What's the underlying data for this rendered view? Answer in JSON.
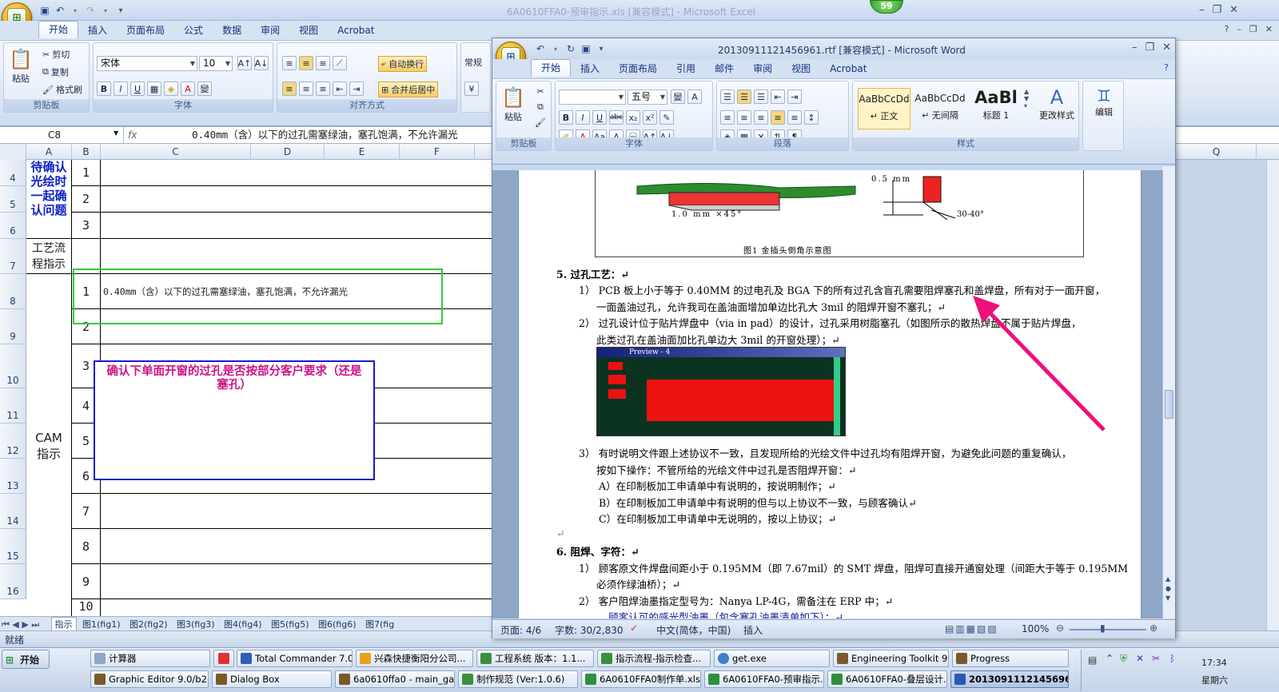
{
  "excel": {
    "title": "6A0610FFA0-预审指示.xls  [兼容模式] - Microsoft Excel",
    "tabs": [
      "开始",
      "插入",
      "页面布局",
      "公式",
      "数据",
      "审阅",
      "视图",
      "Acrobat"
    ],
    "ribbon": {
      "paste": "粘贴",
      "cut": "剪切",
      "copy": "复制",
      "format_painter": "格式刷",
      "clipboard": "剪贴板",
      "font_name": "宋体",
      "font_size": "10",
      "font_group": "字体",
      "align_group": "对齐方式",
      "wrap_text": "自动换行",
      "merge_center": "合并后居中",
      "number_format": "常规"
    },
    "name_box": "C8",
    "formula": "0.40mm（含）以下的过孔需塞绿油，塞孔饱满，不允许漏光",
    "columns": [
      "A",
      "B",
      "C",
      "D",
      "E",
      "F",
      "Q"
    ],
    "rows": [
      "4",
      "5",
      "6",
      "7",
      "8",
      "9",
      "10",
      "11",
      "12",
      "13",
      "14",
      "15",
      "16"
    ],
    "a_confirm": "待确认光绘时一起确认问题",
    "a_process": "工艺流程指示",
    "a_cam": "CAM指示",
    "b_confirm": [
      "1",
      "2",
      "3"
    ],
    "b_cam": [
      "1",
      "2",
      "3",
      "4",
      "5",
      "6",
      "7",
      "8",
      "9",
      "10"
    ],
    "c8_text": "0.40mm（含）以下的过孔需塞绿油，塞孔饱满，不允许漏光",
    "note_text": "确认下单面开窗的过孔是否按部分客户要求（还是塞孔）",
    "sheet_tabs": [
      "指示",
      "图1(fig1)",
      "图2(fig2)",
      "图3(fig3)",
      "图4(fig4)",
      "图5(fig5)",
      "图6(fig6)",
      "图7(fig"
    ],
    "status": "就绪"
  },
  "badge": "59",
  "word": {
    "title": "20130911121456961.rtf [兼容模式] - Microsoft Word",
    "tabs": [
      "开始",
      "插入",
      "页面布局",
      "引用",
      "邮件",
      "审阅",
      "视图",
      "Acrobat"
    ],
    "ribbon": {
      "paste": "粘贴",
      "clipboard": "剪贴板",
      "font_size": "五号",
      "font_group": "字体",
      "para_group": "段落",
      "styles_group": "样式",
      "style1_preview": "AaBbCcDd",
      "style1": "↵ 正文",
      "style2_preview": "AaBbCcDd",
      "style2": "↵ 无间隔",
      "style3_preview": "AaBl",
      "style3": "标题 1",
      "change_styles": "更改样式",
      "edit": "编辑"
    },
    "figure": {
      "dim_left": "1.0 mm ×45°",
      "dim_right_top": "0.5 mm",
      "dim_angle": "30-40°",
      "caption": "图1   金插头倒角示意图"
    },
    "doc": {
      "s5_title": "5.  过孔工艺：↵",
      "s5_1a": "1） PCB 板上小于等于 0.40MM 的过电孔及 BGA 下的所有过孔含盲孔需要阻焊塞孔和盖焊盘，所有对于一面开窗，",
      "s5_1b": "一面盖油过孔，允许我司在盖油面增加单边比孔大 3mil 的阻焊开窗不塞孔；↵",
      "s5_2a": "2） 过孔设计位于贴片焊盘中（via in pad）的设计，过孔采用树脂塞孔（如图所示的散热焊盘不属于贴片焊盘，",
      "s5_2b": "此类过孔在盖油面加比孔单边大 3mil 的开窗处理）；↵",
      "s5_3a": "3） 有时说明文件跟上述协议不一致，且发现所给的光绘文件中过孔均有阻焊开窗，为避免此问题的重复确认，",
      "s5_3b": "按如下操作：不管所给的光绘文件中过孔是否阻焊开窗：↵",
      "s5_3A": "A）在印制板加工申请单中有说明的，按说明制作；↵",
      "s5_3B": "B）在印制板加工申请单中有说明的但与以上协议不一致，与顾客确认↵",
      "s5_3C": "C）在印制板加工申请单中无说明的，按以上协议；↵",
      "blank": "↵",
      "s6_title": "6.  阻焊、字符：↵",
      "s6_1a": "1） 顾客原文件焊盘间距小于 0.195MM（即 7.67mil）的 SMT 焊盘，阻焊可直接开通窗处理（间距大于等于 0.195MM",
      "s6_1b": "必须作绿油桥）；↵",
      "s6_2": "2） 客户阻焊油墨指定型号为：Nanya LP-4G，需备注在 ERP 中；↵",
      "s6_3": "顾客认可的感光型油墨（包含塞孔油墨清单如下）：↵",
      "preview_title": "Preview - 4"
    },
    "status": {
      "page": "页面: 4/6",
      "words": "字数: 30/2,830",
      "lang": "中文(简体，中国)",
      "insert": "插入",
      "zoom": "100%"
    }
  },
  "taskbar": {
    "start": "开始",
    "row1": [
      "计算器",
      "Total Commander 7.0 ...",
      "兴森快捷衡阳分公司...",
      "工程系统  版本：1.1...",
      "指示流程-指示检查...",
      "get.exe",
      "Engineering Toolkit 9.0...",
      "Progress"
    ],
    "row2": [
      "Graphic Editor 9.0/b2 (...",
      "Dialog Box",
      "6a0610ffa0 - main_ga...",
      "制作规范 (Ver:1.0.6)",
      "6A0610FFA0制作单.xls...",
      "6A0610FFA0-预审指示...",
      "6A0610FFA0-叠层设计...",
      "20130911121456961..."
    ],
    "clock": "17:34",
    "day": "星期六"
  },
  "colors": {
    "note_border": "#1a1acc",
    "note_text": "#cc1188",
    "arrow": "#ee1177",
    "highlight_box": "#33cc33",
    "row_header_text": "#27406b"
  }
}
